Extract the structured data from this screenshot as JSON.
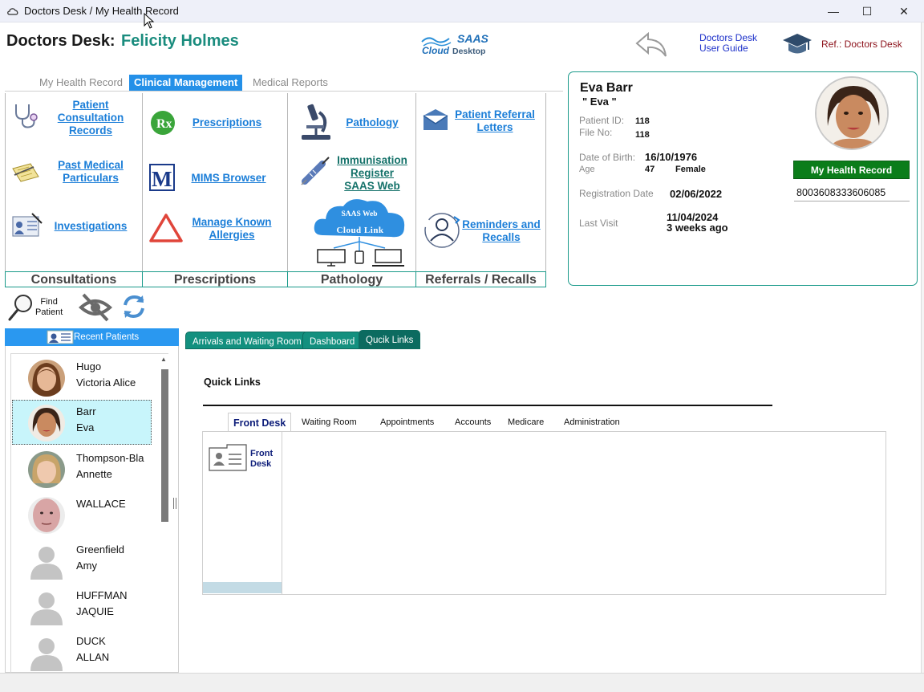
{
  "window": {
    "title": "Doctors Desk / My Health Record",
    "minimize": "—",
    "maximize": "☐",
    "close": "✕"
  },
  "header": {
    "label": "Doctors Desk:",
    "doctor_name": "Felicity Holmes",
    "logo_top": "SAAS",
    "logo_left": "Cloud",
    "logo_right": "Desktop",
    "guide_line1": "Doctors Desk",
    "guide_line2": "User Guide",
    "ref": "Ref.: Doctors Desk"
  },
  "top_tabs": [
    {
      "label": "My Health Record",
      "active": false
    },
    {
      "label": "Clinical Management",
      "active": true
    },
    {
      "label": "Medical Reports",
      "active": false
    }
  ],
  "modules": {
    "consultations": {
      "patient_consult_1": "Patient",
      "patient_consult_2": "Consultation",
      "patient_consult_3": "Records",
      "past_medical_1": "Past Medical",
      "past_medical_2": "Particulars",
      "investigations": "Investigations"
    },
    "prescriptions": {
      "prescriptions": "Prescriptions",
      "mims": "MIMS Browser",
      "allergies_1": "Manage Known",
      "allergies_2": "Allergies"
    },
    "pathology": {
      "pathology": "Pathology",
      "immunisation_1": "Immunisation",
      "immunisation_2": "Register",
      "immunisation_3": "SAAS Web",
      "cloud_1": "SAAS Web",
      "cloud_2": "Cloud Link"
    },
    "referrals": {
      "referral_1": "Patient Referral",
      "referral_2": "Letters",
      "reminders_1": "Reminders and",
      "reminders_2": "Recalls"
    }
  },
  "categories": [
    "Consultations",
    "Prescriptions",
    "Pathology",
    "Referrals / Recalls"
  ],
  "patient_card": {
    "name": "Eva Barr",
    "nickname": "\" Eva \"",
    "patient_id_label": "Patient ID:",
    "patient_id": "118",
    "file_no_label": "File No:",
    "file_no": "118",
    "dob_label": "Date of Birth:",
    "dob": "16/10/1976",
    "age_label": "Age",
    "age": "47",
    "sex": "Female",
    "reg_label": "Registration Date",
    "reg_date": "02/06/2022",
    "last_visit_label": "Last Visit",
    "last_visit_date": "11/04/2024",
    "last_visit_ago": "3 weeks ago",
    "mhr_button": "My Health Record",
    "mhr_number": "8003608333606085"
  },
  "toolbar": {
    "find_1": "Find",
    "find_2": "Patient"
  },
  "recent": {
    "header": "Recent Patients",
    "patients": [
      {
        "surname": "Hugo",
        "given": "Victoria Alice",
        "selected": false,
        "photo": "woman-brown-hair"
      },
      {
        "surname": "Barr",
        "given": "Eva",
        "selected": true,
        "photo": "woman-dark-hair"
      },
      {
        "surname": "Thompson-Bla",
        "given": "Annette",
        "selected": false,
        "photo": "woman-blonde"
      },
      {
        "surname": "WALLACE",
        "given": "",
        "selected": false,
        "photo": "man-bald"
      },
      {
        "surname": "Greenfield",
        "given": "Amy",
        "selected": false,
        "photo": "placeholder"
      },
      {
        "surname": "HUFFMAN",
        "given": "JAQUIE",
        "selected": false,
        "photo": "placeholder"
      },
      {
        "surname": "DUCK",
        "given": "ALLAN",
        "selected": false,
        "photo": "placeholder"
      }
    ]
  },
  "main_tabs": [
    {
      "label": "Arrivals and Waiting Room",
      "active": false
    },
    {
      "label": "Dashboard",
      "active": false
    },
    {
      "label": "Qucik Links",
      "active": true
    }
  ],
  "quick_links": {
    "title": "Quick Links",
    "tabs": [
      "Front Desk",
      "Waiting Room",
      "Appointments",
      "Accounts",
      "Medicare",
      "Administration"
    ],
    "front_desk_1": "Front",
    "front_desk_2": "Desk"
  },
  "colors": {
    "accent_blue": "#2490e8",
    "teal": "#1a9a8a",
    "mhr_green": "#0b7d1a"
  }
}
